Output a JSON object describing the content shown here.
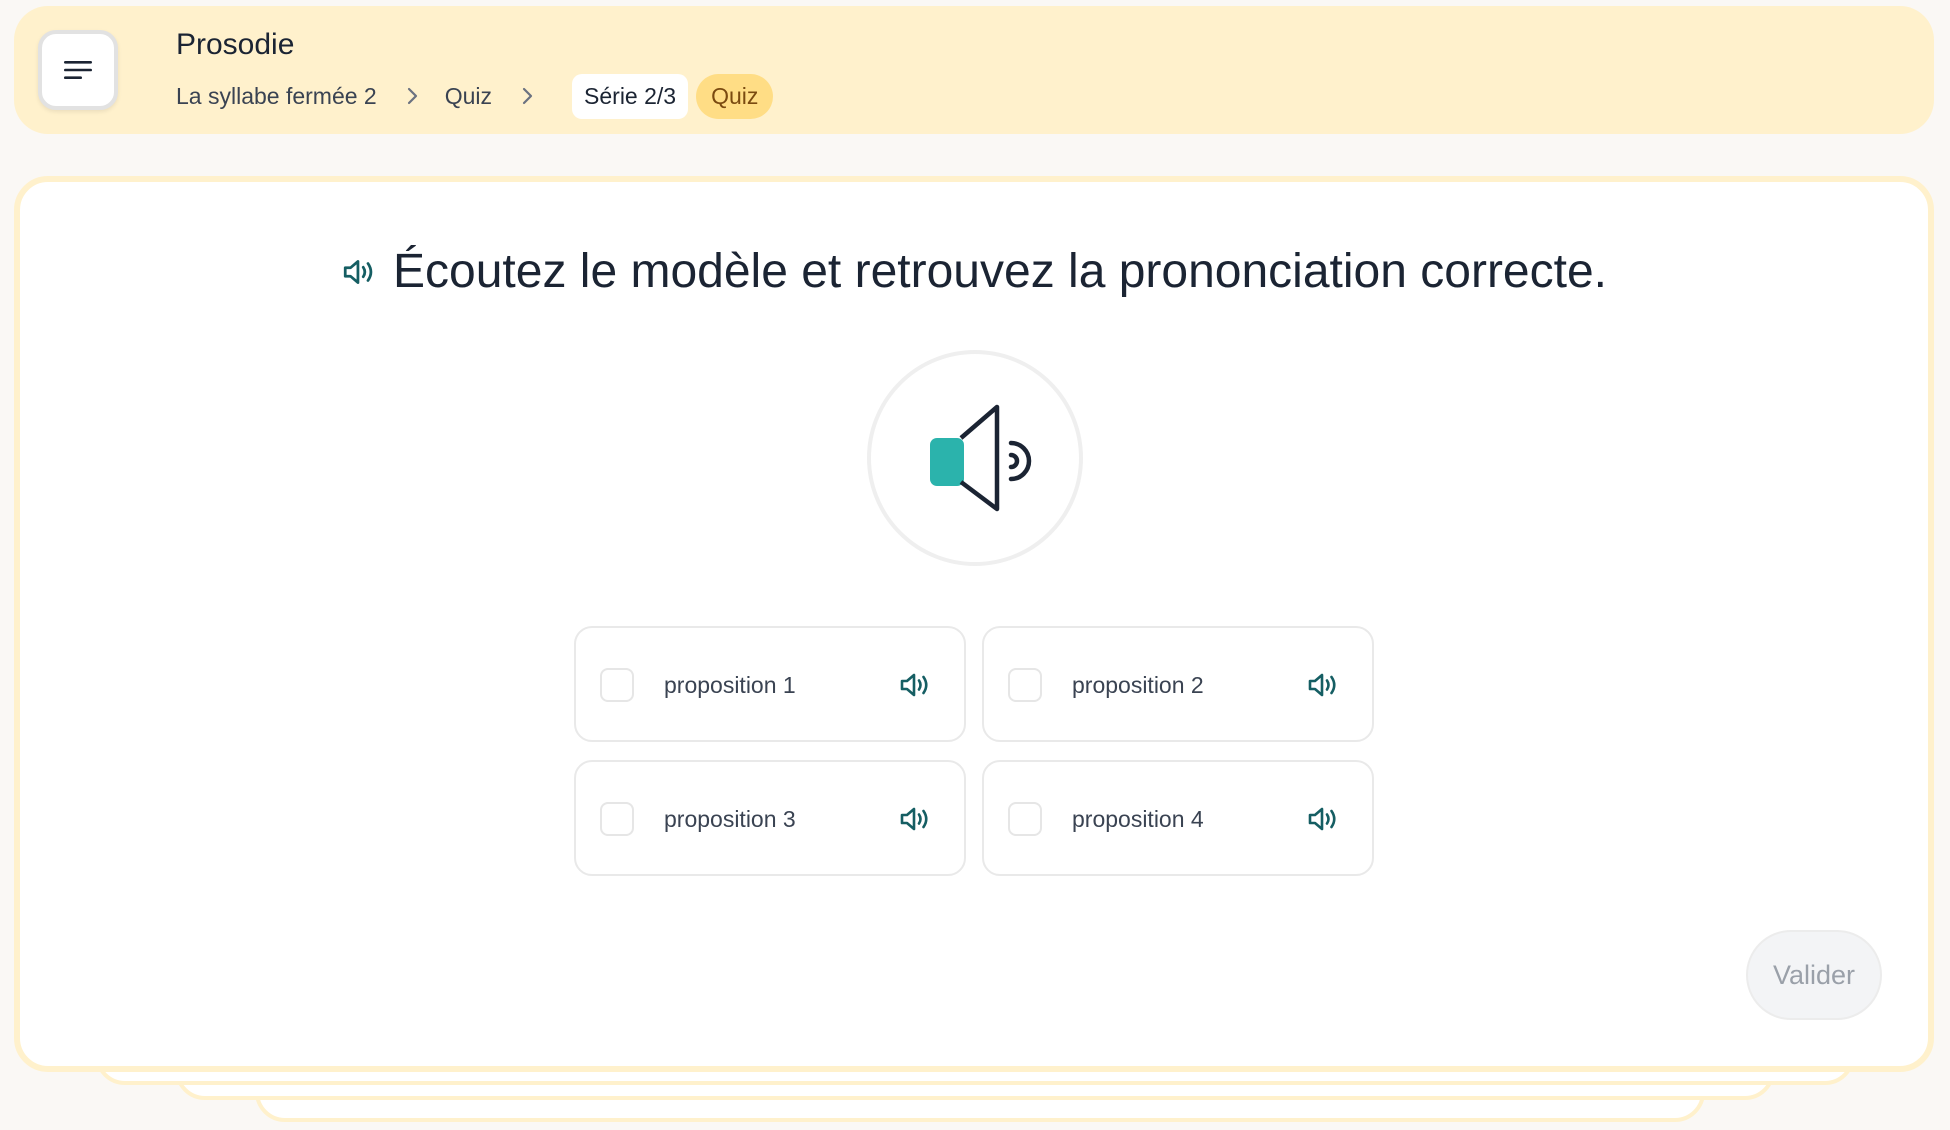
{
  "header": {
    "title": "Prosodie",
    "breadcrumb": {
      "item1": "La syllabe fermée 2",
      "item2": "Quiz",
      "current": "Série 2/3",
      "badge": "Quiz"
    }
  },
  "question": {
    "text": "Écoutez le modèle et retrouvez la prononciation correcte."
  },
  "options": [
    {
      "label": "proposition 1"
    },
    {
      "label": "proposition 2"
    },
    {
      "label": "proposition 3"
    },
    {
      "label": "proposition 4"
    }
  ],
  "actions": {
    "validate_label": "Valider"
  },
  "colors": {
    "accent_teal": "#2bb3ac",
    "icon_dark_teal": "#155e63",
    "header_bg": "#fff1cc",
    "badge_bg": "#ffdd85"
  },
  "icons": {
    "menu": "hamburger-icon",
    "chevron": "chevron-right-icon",
    "audio": "speaker-icon"
  }
}
